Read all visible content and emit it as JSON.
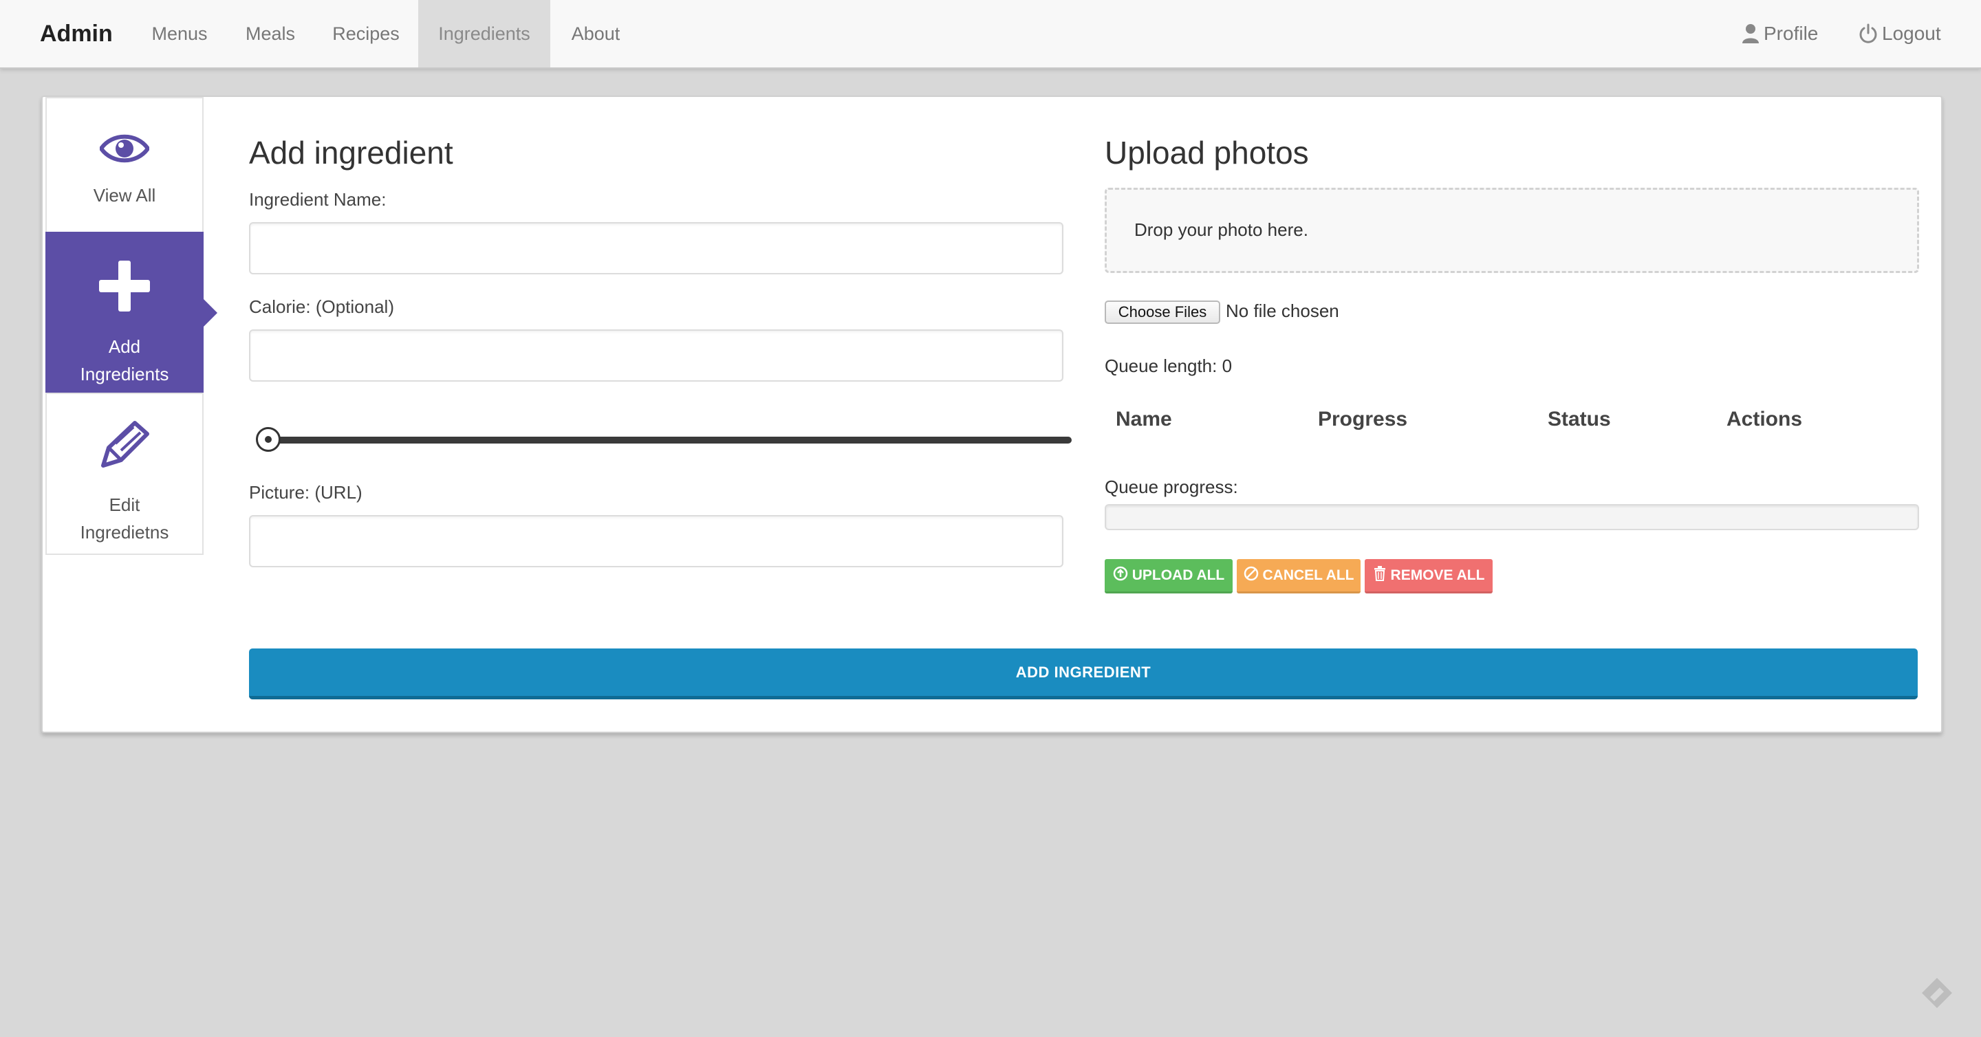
{
  "navbar": {
    "brand": "Admin",
    "links": [
      {
        "label": "Menus",
        "active": false
      },
      {
        "label": "Meals",
        "active": false
      },
      {
        "label": "Recipes",
        "active": false
      },
      {
        "label": "Ingredients",
        "active": true
      },
      {
        "label": "About",
        "active": false
      }
    ],
    "profile_label": "Profile",
    "profile_icon": "user-icon",
    "logout_label": "Logout",
    "logout_icon": "power-icon"
  },
  "sidebar": {
    "items": [
      {
        "label": "View All",
        "icon": "eye-icon",
        "active": false
      },
      {
        "label_line1": "Add",
        "label_line2": "Ingredients",
        "icon": "plus-icon",
        "active": true
      },
      {
        "label_line1": "Edit",
        "label_line2": "Ingredietns",
        "icon": "pen-icon",
        "active": false
      }
    ],
    "accent_color": "#5c4ea6"
  },
  "form": {
    "title": "Add ingredient",
    "name_label": "Ingredient Name:",
    "name_value": "",
    "calorie_label": "Calorie: (Optional)",
    "calorie_value": "",
    "slider_value": 0,
    "picture_label": "Picture: (URL)",
    "picture_value": ""
  },
  "upload": {
    "title": "Upload photos",
    "dropzone_text": "Drop your photo here.",
    "choose_button": "Choose Files",
    "no_file_text": "No file chosen",
    "queue_length_text": "Queue length: 0",
    "table_headers": [
      "Name",
      "Progress",
      "Status",
      "Actions"
    ],
    "queue_progress_label": "Queue progress:",
    "queue_progress_value": 0,
    "upload_all": "UPLOAD ALL",
    "cancel_all": "CANCEL ALL",
    "remove_all": "REMOVE ALL"
  },
  "submit_button": "ADD INGREDIENT",
  "colors": {
    "primary": "#1a8cc0",
    "success": "#5cbd5c",
    "warning": "#f6aa55",
    "danger": "#f07070"
  }
}
